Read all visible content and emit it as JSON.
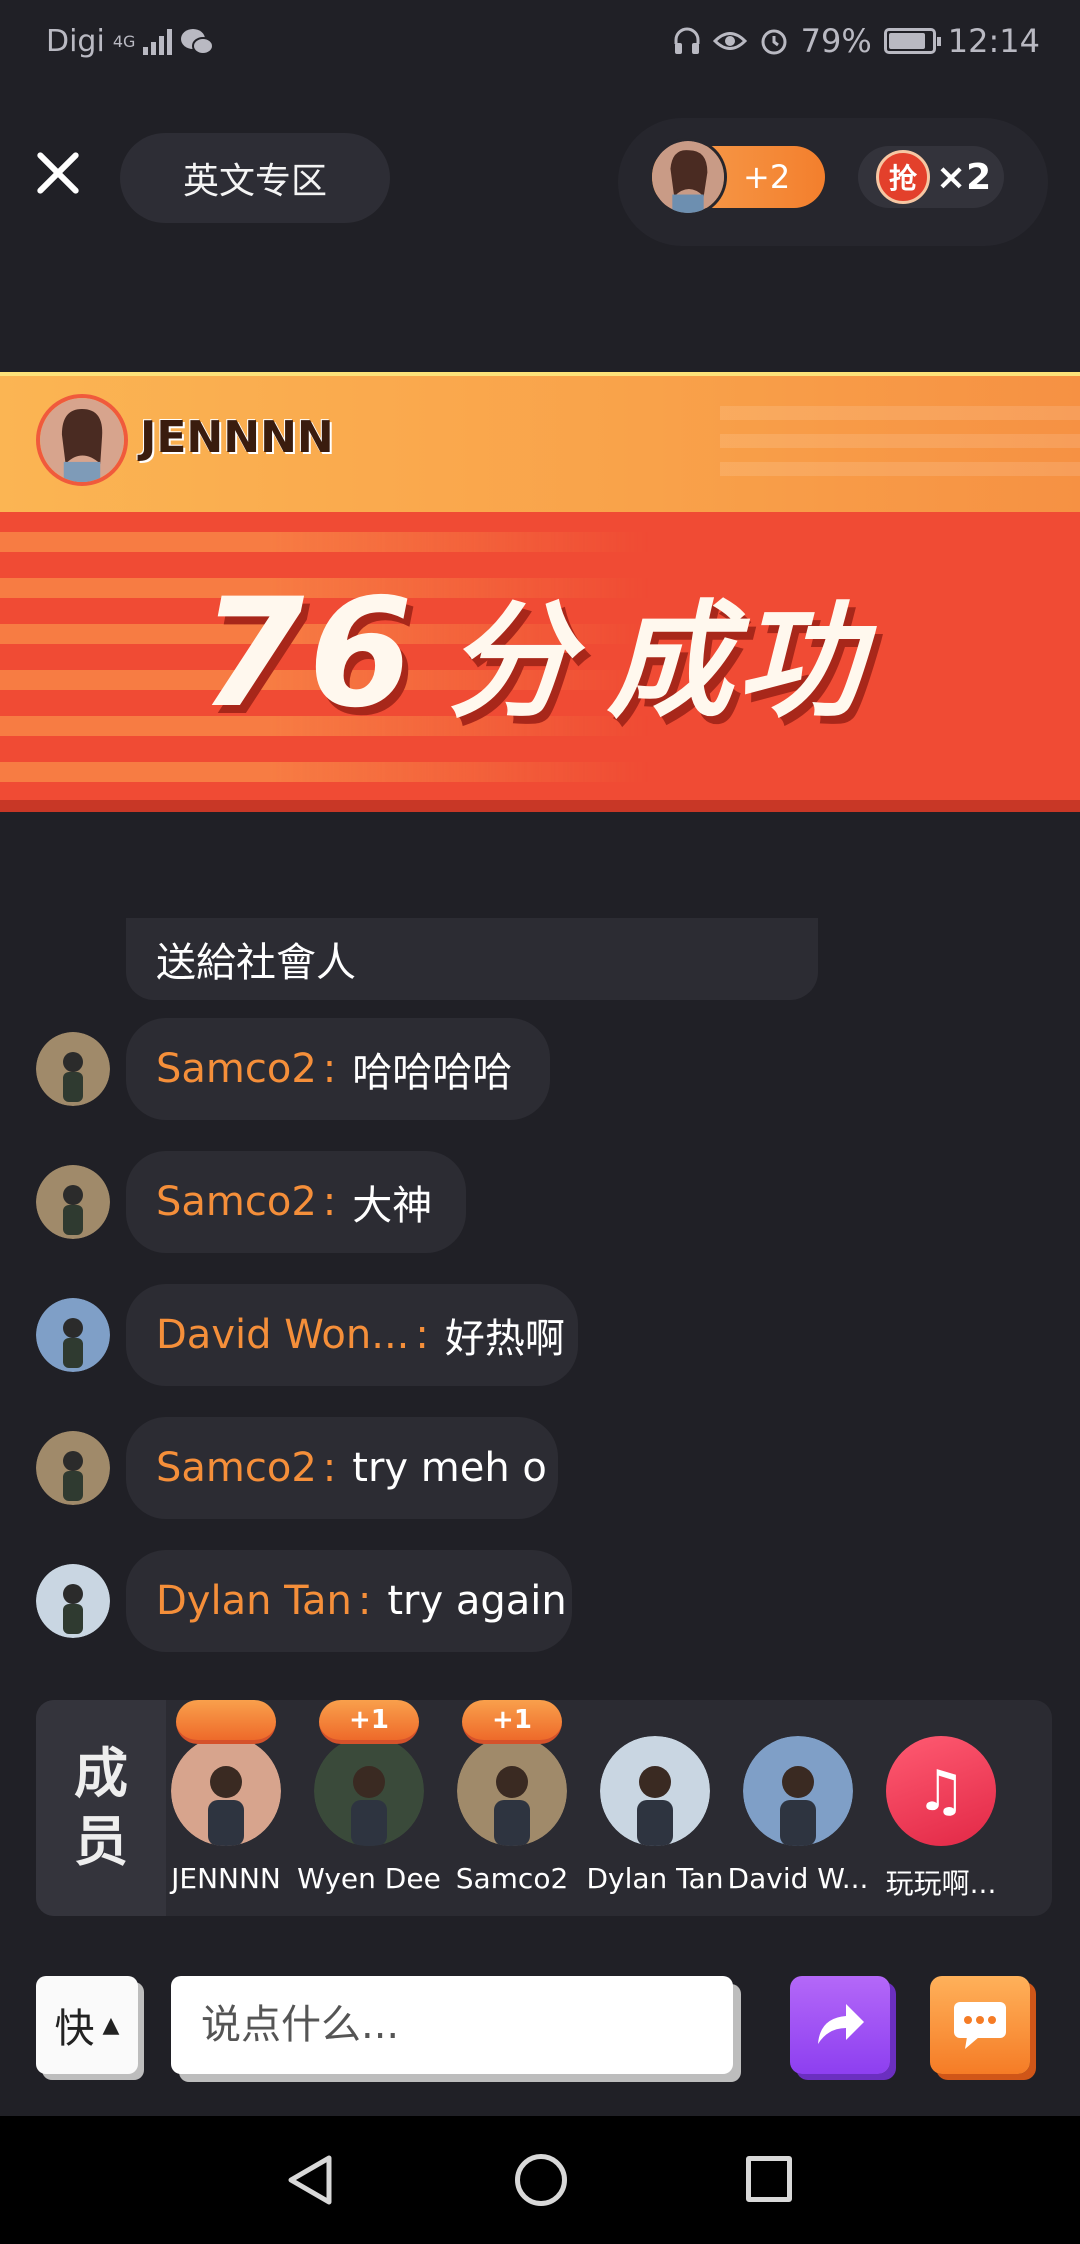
{
  "status_bar": {
    "carrier": "Digi",
    "network": "4G",
    "battery": "79%",
    "time": "12:14"
  },
  "header": {
    "zone_label": "英文专区",
    "grab_count": "+2",
    "rob_icon_text": "抢",
    "rob_count": "×2"
  },
  "banner": {
    "username": "JENNNN",
    "score": "76",
    "unit": "分",
    "result": "成功"
  },
  "chat": {
    "first_message": "送給社會人",
    "messages": [
      {
        "user": "Samco2",
        "text": "哈哈哈哈"
      },
      {
        "user": "Samco2",
        "text": "大神"
      },
      {
        "user": "David Won...",
        "text": "好热啊"
      },
      {
        "user": "Samco2",
        "text": "try meh o"
      },
      {
        "user": "Dylan Tan",
        "text": "try again"
      }
    ],
    "separator": ":"
  },
  "members": {
    "label_line1": "成",
    "label_line2": "员",
    "list": [
      {
        "name": "JENNNN",
        "tag": ""
      },
      {
        "name": "Wyen Dee",
        "tag": "+1"
      },
      {
        "name": "Samco2",
        "tag": "+1"
      },
      {
        "name": "Dylan Tan",
        "tag": ""
      },
      {
        "name": "David W...",
        "tag": ""
      },
      {
        "name": "玩玩啊...",
        "tag": ""
      }
    ]
  },
  "input_bar": {
    "quick_label": "快",
    "placeholder": "说点什么..."
  },
  "colors": {
    "background": "#202026",
    "accent_orange": "#f58f3a",
    "banner_red": "#f04b34",
    "share_purple": "#8d3ff0"
  }
}
